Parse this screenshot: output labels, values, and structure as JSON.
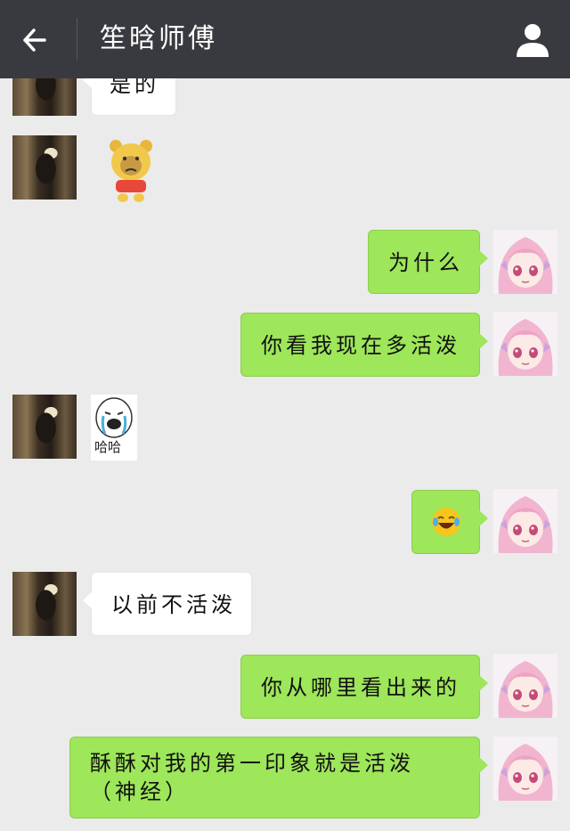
{
  "header": {
    "title": "笙晗师傅"
  },
  "messages": [
    {
      "side": "left",
      "type": "text",
      "text": "是的"
    },
    {
      "side": "left",
      "type": "sticker",
      "sticker": "bear-face-sticker"
    },
    {
      "side": "right",
      "type": "text",
      "text": "为什么"
    },
    {
      "side": "right",
      "type": "text",
      "text": "你看我现在多活泼"
    },
    {
      "side": "left",
      "type": "sticker",
      "sticker": "crying-face-sticker",
      "caption": "哈哈"
    },
    {
      "side": "right",
      "type": "emoji",
      "emoji": "laughing-crying-emoji"
    },
    {
      "side": "left",
      "type": "text",
      "text": "以前不活泼"
    },
    {
      "side": "right",
      "type": "text",
      "text": "你从哪里看出来的"
    },
    {
      "side": "right",
      "type": "text",
      "text": "酥酥对我的第一印象就是活泼（神经）"
    }
  ],
  "icons": {
    "back": "back-arrow-icon",
    "profile": "person-icon"
  },
  "colors": {
    "header_bg": "#393a3f",
    "chat_bg": "#ebebeb",
    "sent_bubble": "#9ee65a",
    "received_bubble": "#ffffff"
  }
}
